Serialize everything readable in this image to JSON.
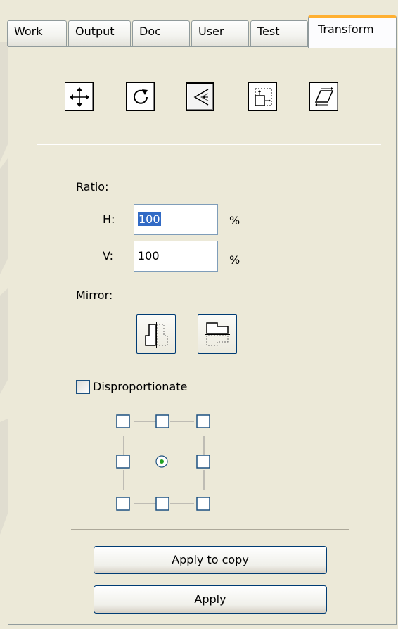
{
  "tabs": [
    {
      "label": "Work",
      "active": false
    },
    {
      "label": "Output",
      "active": false
    },
    {
      "label": "Doc",
      "active": false
    },
    {
      "label": "User",
      "active": false
    },
    {
      "label": "Test",
      "active": false
    },
    {
      "label": "Transform",
      "active": true
    }
  ],
  "modes": [
    {
      "icon": "move-icon",
      "pressed": false
    },
    {
      "icon": "rotate-icon",
      "pressed": false
    },
    {
      "icon": "scale-icon",
      "pressed": true
    },
    {
      "icon": "size-icon",
      "pressed": false
    },
    {
      "icon": "skew-icon",
      "pressed": false
    }
  ],
  "ratio": {
    "label": "Ratio:",
    "h_label": "H:",
    "h_value": "100",
    "v_label": "V:",
    "v_value": "100",
    "unit": "%"
  },
  "mirror": {
    "label": "Mirror:",
    "horizontal_icon": "mirror-horizontal-icon",
    "vertical_icon": "mirror-vertical-icon"
  },
  "disproportionate": {
    "label": "Disproportionate",
    "checked": false
  },
  "anchor": {
    "selected": "center"
  },
  "buttons": {
    "apply_copy": "Apply to copy",
    "apply": "Apply"
  },
  "colors": {
    "tab_highlight": "#ffb032",
    "selection": "#316ac5",
    "panel_bg": "#ece9d8"
  }
}
